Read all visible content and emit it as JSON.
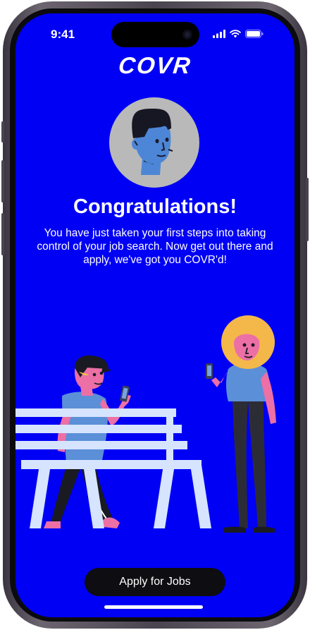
{
  "status_bar": {
    "time": "9:41"
  },
  "brand": {
    "logo": "COVR",
    "accent_color": "#0000f5"
  },
  "content": {
    "title": "Congratulations!",
    "message": "You have just taken your first steps into taking control of your job search. Now get out there and apply, we've got you COVR'd!"
  },
  "actions": {
    "primary_label": "Apply for Jobs"
  },
  "icons": {
    "signal": "signal-icon",
    "wifi": "wifi-icon",
    "battery": "battery-icon"
  }
}
